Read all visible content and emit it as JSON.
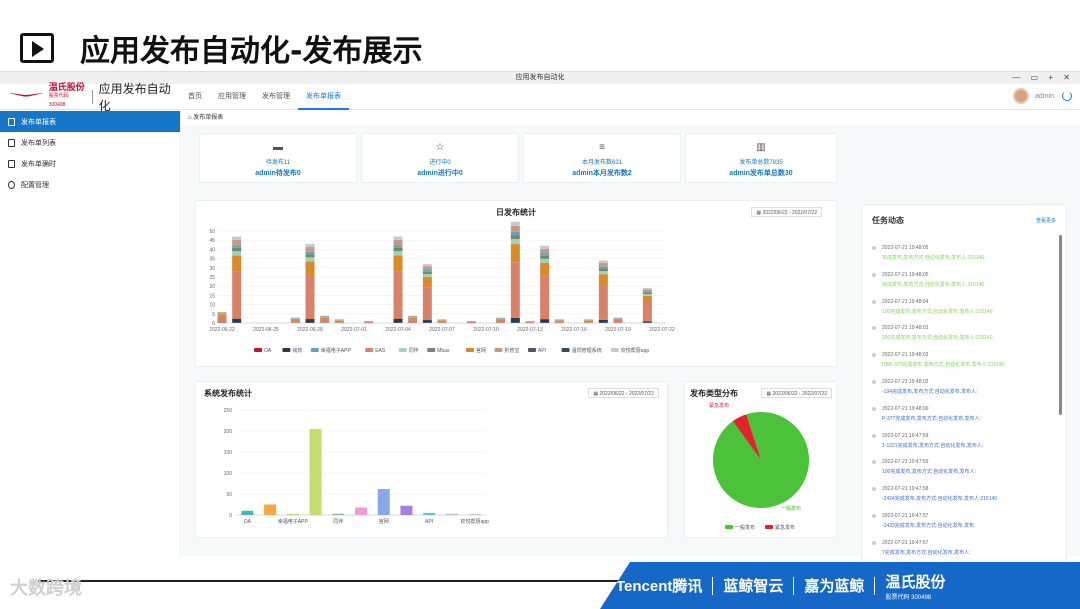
{
  "slide": {
    "title": "应用发布自动化-发布展示"
  },
  "window": {
    "title": "应用发布自动化",
    "controls": "— ▭ + ✕"
  },
  "brand": {
    "cn_name": "温氏股份",
    "stock_code": "股票代码 300498",
    "app_name": "应用发布自动化"
  },
  "nav": [
    {
      "label": "首页"
    },
    {
      "label": "应用管理"
    },
    {
      "label": "发布管理"
    },
    {
      "label": "发布单报表",
      "active": true
    }
  ],
  "user": {
    "name": "admin."
  },
  "sidebar": [
    {
      "label": "发布单报表",
      "icon": "document-icon",
      "active": true
    },
    {
      "label": "发布单列表",
      "icon": "list-icon"
    },
    {
      "label": "发布单确时",
      "icon": "file-icon"
    },
    {
      "label": "配置管理",
      "icon": "gear-icon"
    }
  ],
  "breadcrumb": "发布单报表",
  "stats": [
    {
      "icon": "chat-icon",
      "line1": "待发布11",
      "line2": "admin待发布0"
    },
    {
      "icon": "star-icon",
      "line1": "进行中0",
      "line2": "admin进行中0"
    },
    {
      "icon": "doc-lines-icon",
      "line1": "本月发布数631",
      "line2": "admin本月发布数2"
    },
    {
      "icon": "bar-chart-icon",
      "line1": "发布单总数7835",
      "line2": "admin发布单总数30"
    }
  ],
  "daily_chart": {
    "title": "日发布统计",
    "date_range": "2022/06/22 - 2022/07/22"
  },
  "system_chart": {
    "title": "系统发布统计",
    "date_range": "2022/06/22 - 2022/07/22"
  },
  "type_chart": {
    "title": "发布类型分布",
    "date_range": "2022/06/22 - 2022/07/22"
  },
  "chart_data": [
    {
      "type": "bar",
      "title": "日发布统计",
      "stacked": true,
      "ylim": [
        0,
        50
      ],
      "yticks": [
        0,
        5,
        10,
        15,
        20,
        25,
        30,
        35,
        40,
        45,
        50
      ],
      "x_tick_labels": [
        "2022-06-22",
        "2022-06-25",
        "2022-06-28",
        "2022-07-01",
        "2022-07-04",
        "2022-07-07",
        "2022-07-10",
        "2022-07-13",
        "2022-07-16",
        "2022-07-19",
        "2022-07-22"
      ],
      "legend": [
        "OA",
        "钱软",
        "幸福电子APP",
        "EAS",
        "同伴",
        "Mbas",
        "官网",
        "折普宝",
        "API",
        "温饲管理系统",
        "钦悦帮厨app"
      ],
      "legend_colors": [
        "#c8102e",
        "#2b3a4a",
        "#6a9fb5",
        "#d9826a",
        "#9fd3c1",
        "#6e8b6e",
        "#d98a2b",
        "#c39a8a",
        "#4d5866",
        "#3a4a5a",
        "#c9c9c9"
      ],
      "bars": [
        {
          "day": 0,
          "total": 6
        },
        {
          "day": 1,
          "total": 47
        },
        {
          "day": 5,
          "total": 3
        },
        {
          "day": 6,
          "total": 43
        },
        {
          "day": 7,
          "total": 4
        },
        {
          "day": 8,
          "total": 2
        },
        {
          "day": 10,
          "total": 1
        },
        {
          "day": 12,
          "total": 47
        },
        {
          "day": 13,
          "total": 4
        },
        {
          "day": 14,
          "total": 32
        },
        {
          "day": 15,
          "total": 2
        },
        {
          "day": 17,
          "total": 1
        },
        {
          "day": 19,
          "total": 3
        },
        {
          "day": 20,
          "total": 55
        },
        {
          "day": 21,
          "total": 1
        },
        {
          "day": 22,
          "total": 42
        },
        {
          "day": 23,
          "total": 2
        },
        {
          "day": 25,
          "total": 2
        },
        {
          "day": 26,
          "total": 34
        },
        {
          "day": 27,
          "total": 3
        },
        {
          "day": 29,
          "total": 19
        }
      ]
    },
    {
      "type": "bar",
      "title": "系统发布统计",
      "ylim": [
        0,
        250
      ],
      "yticks": [
        0,
        50,
        100,
        150,
        200,
        250
      ],
      "categories": [
        "OA",
        "",
        "幸福电子APP",
        "",
        "同伴",
        "",
        "官网",
        "",
        "API",
        "",
        "钦悦帮厨app"
      ],
      "values": [
        10,
        25,
        2,
        205,
        3,
        18,
        62,
        22,
        5,
        3,
        2
      ],
      "colors": [
        "#4bb3c4",
        "#f5a742",
        "#9ccf5a",
        "#c5dc73",
        "#7fc28f",
        "#f29ad3",
        "#88a8e8",
        "#a87ee0",
        "#5ec7d1",
        "#c0c0c0",
        "#c0c0c0"
      ]
    },
    {
      "type": "pie",
      "title": "发布类型分布",
      "slices": [
        {
          "name": "一般发布",
          "value": 95,
          "color": "#4cc13a"
        },
        {
          "name": "紧急发布",
          "value": 5,
          "color": "#e0242c"
        }
      ]
    }
  ],
  "feed": {
    "title": "任务动态",
    "more": "查看更多",
    "items": [
      {
        "time": "2022-07-21 19:48:05",
        "msg": "完成发布,发布方式:自动化发布,发布人:215140",
        "color": "green"
      },
      {
        "time": "2022-07-21 19:48:05",
        "msg": "完成发布,发布方式:自动化发布,发布人:215140",
        "color": "green"
      },
      {
        "time": "2022-07-21 19:48:04",
        "msg": "100完成发布,发布方式:自动化发布,发布人:215140",
        "color": "green"
      },
      {
        "time": "2022-07-21 19:48:03",
        "msg": "300完成发布,发布方式:自动化发布,发布人:215140",
        "color": "green"
      },
      {
        "time": "2022-07-21 19:48:03",
        "msg": "HBP-377完成发布,发布方式:自动化发布,发布人:215140",
        "color": "green"
      },
      {
        "time": "2022-07-21 19:48:02",
        "msg": "-194完成发布,发布方式:自动化发布,发布人:",
        "color": "blue"
      },
      {
        "time": "2022-07-21 19:48:00",
        "msg": "P-377完成发布,发布方式:自动化发布,发布人:",
        "color": "blue"
      },
      {
        "time": "2022-07-21 19:47:59",
        "msg": "1-1221完成发布,发布方式:自动化发布,发布人:",
        "color": "blue"
      },
      {
        "time": "2022-07-21 19:47:59",
        "msg": "100完成发布,发布方式:自动化发布,发布人:",
        "color": "blue"
      },
      {
        "time": "2022-07-21 19:47:58",
        "msg": "-2424完成发布,发布方式:自动化发布,发布人:215140",
        "color": "blue"
      },
      {
        "time": "2022-07-21 19:47:57",
        "msg": "-2433完成发布,发布方式:自动化发布,发布",
        "color": "blue"
      },
      {
        "time": "2022-07-21 19:47:57",
        "msg": "7完成发布,发布方式:自动化发布,发布人:",
        "color": "blue"
      }
    ]
  },
  "footer": {
    "watermark": "大数跨境",
    "partners": [
      "Tencent腾讯",
      "蓝鲸智云",
      "嘉为蓝鲸",
      "温氏股份"
    ],
    "partner_code": "股票代码 300498"
  }
}
